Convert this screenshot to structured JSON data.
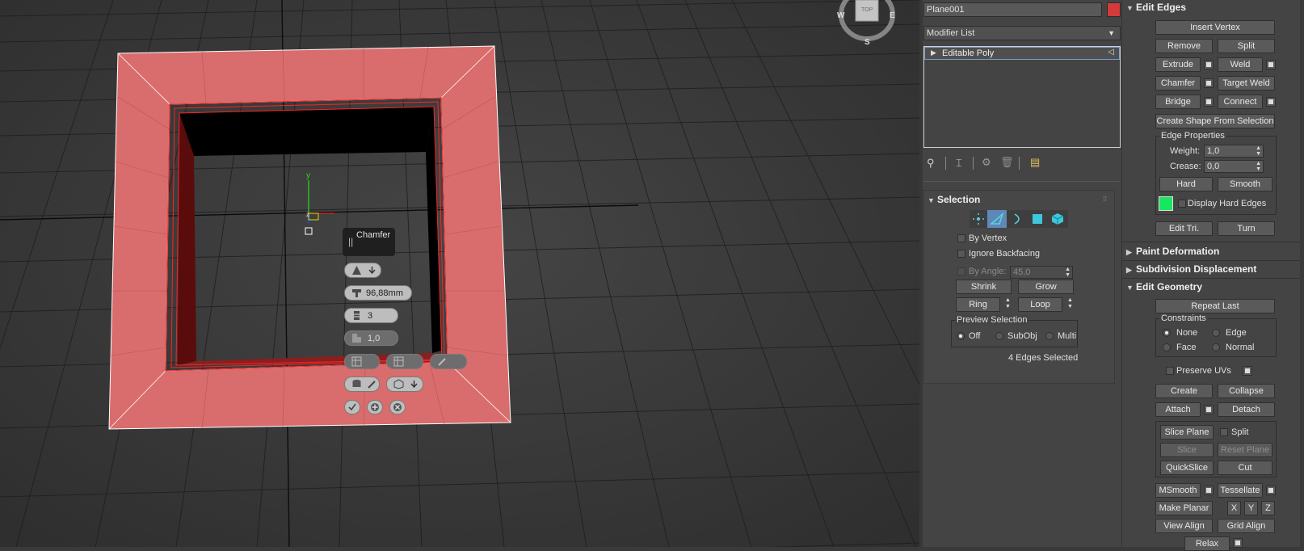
{
  "viewport": {
    "viewcube": {
      "top": "TOP",
      "w": "W",
      "e": "E",
      "s": "S"
    },
    "gizmo": {
      "y": "y",
      "z": "z"
    },
    "caddy": {
      "title": "Chamfer",
      "amount": "96,88mm",
      "segments": "3",
      "tension": "1,0"
    }
  },
  "modify_panel": {
    "object_name": "Plane001",
    "object_color": "#d33a3a",
    "modifier_list": "Modifier List",
    "stack_item": "Editable Poly"
  },
  "selection": {
    "title": "Selection",
    "by_vertex": "By Vertex",
    "ignore_backfacing": "Ignore Backfacing",
    "by_angle": "By Angle:",
    "by_angle_value": "45,0",
    "shrink": "Shrink",
    "grow": "Grow",
    "ring": "Ring",
    "loop": "Loop",
    "preview_selection": "Preview Selection",
    "off": "Off",
    "subobj": "SubObj",
    "multi": "Multi",
    "status": "4 Edges Selected"
  },
  "edit_edges": {
    "title": "Edit Edges",
    "insert_vertex": "Insert Vertex",
    "remove": "Remove",
    "split": "Split",
    "extrude": "Extrude",
    "weld": "Weld",
    "chamfer": "Chamfer",
    "target_weld": "Target Weld",
    "bridge": "Bridge",
    "connect": "Connect",
    "create_shape": "Create Shape From Selection",
    "edge_properties": "Edge Properties",
    "weight_label": "Weight:",
    "weight_value": "1,0",
    "crease_label": "Crease:",
    "crease_value": "0,0",
    "hard": "Hard",
    "smooth": "Smooth",
    "hard_edge_color": "#19e660",
    "display_hard_edges": "Display Hard Edges",
    "edit_tri": "Edit Tri.",
    "turn": "Turn"
  },
  "rollouts": {
    "paint_deformation": "Paint Deformation",
    "subdivision_displacement": "Subdivision Displacement",
    "edit_geometry": "Edit Geometry"
  },
  "edit_geometry": {
    "repeat_last": "Repeat Last",
    "constraints": "Constraints",
    "none": "None",
    "edge": "Edge",
    "face": "Face",
    "normal": "Normal",
    "preserve_uvs": "Preserve UVs",
    "create": "Create",
    "collapse": "Collapse",
    "attach": "Attach",
    "detach": "Detach",
    "slice_plane": "Slice Plane",
    "split": "Split",
    "slice": "Slice",
    "reset_plane": "Reset Plane",
    "quickslice": "QuickSlice",
    "cut": "Cut",
    "msmooth": "MSmooth",
    "tessellate": "Tessellate",
    "make_planar": "Make Planar",
    "x": "X",
    "y": "Y",
    "z": "Z",
    "view_align": "View Align",
    "grid_align": "Grid Align",
    "relax": "Relax"
  }
}
